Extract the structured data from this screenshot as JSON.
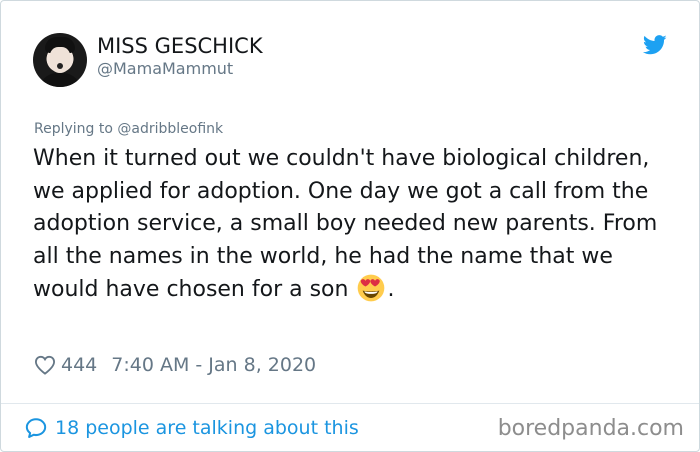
{
  "tweet": {
    "display_name": "MISS GESCHICK",
    "handle": "@MamaMammut",
    "replying_prefix": "Replying to",
    "replying_to": "@adribbleofink",
    "text": "When it turned out we couldn't have biological children, we applied for adoption. One day we got a call from the adoption service, a small boy needed new parents. From all the names in the world, he had the name that we would have chosen for a son",
    "text_suffix": ".",
    "emoji": "heart-eyes-emoji",
    "likes": "444",
    "timestamp": "7:40 AM - Jan 8, 2020",
    "talking": "18 people are talking about this"
  },
  "icons": {
    "twitter": "twitter-bird-icon",
    "like": "heart-outline-icon",
    "talking": "speech-bubble-icon"
  },
  "watermark": "boredpanda.com",
  "colors": {
    "accent": "#1b95e0",
    "twitter_blue": "#1da1f2",
    "secondary_text": "#657786",
    "primary_text": "#14171a",
    "watermark": "#8d8d8d"
  }
}
